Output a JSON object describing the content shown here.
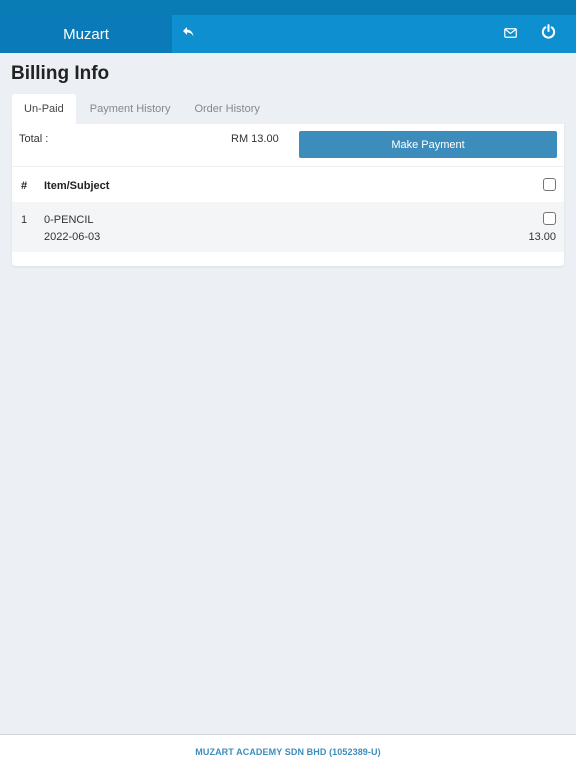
{
  "header": {
    "brand": "Muzart",
    "accent_color": "#0d8fd0",
    "brand_bg": "#0b7ab9",
    "icons": [
      "reply-icon",
      "mail-icon",
      "power-icon"
    ]
  },
  "page": {
    "title": "Billing Info"
  },
  "tabs": [
    {
      "label": "Un-Paid",
      "active": true
    },
    {
      "label": "Payment History",
      "active": false
    },
    {
      "label": "Order History",
      "active": false
    }
  ],
  "summary": {
    "total_label": "Total :",
    "total_amount": "RM 13.00",
    "pay_button": "Make Payment",
    "pay_button_color": "#3c8dbc"
  },
  "table": {
    "headers": {
      "num": "#",
      "item": "Item/Subject"
    },
    "select_all_checked": false,
    "rows": [
      {
        "num": "1",
        "item": "0-PENCIL",
        "date": "2022-06-03",
        "price": "13.00",
        "checked": false
      }
    ]
  },
  "footer": {
    "text": "MUZART ACADEMY SDN BHD (1052389-U)"
  }
}
